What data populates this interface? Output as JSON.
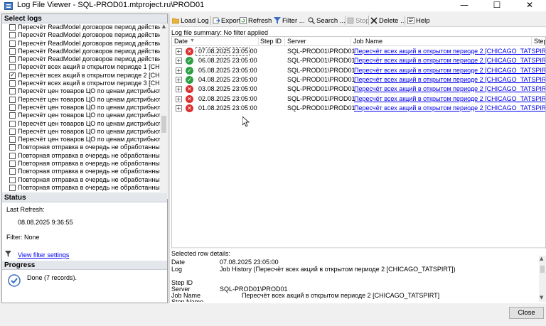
{
  "window": {
    "title": "Log File Viewer - SQL-PROD01.mtproject.ru\\PROD01",
    "minimize": "—",
    "maximize": "☐",
    "close": "✕"
  },
  "left": {
    "select_logs_header": "Select logs",
    "logs": [
      {
        "label": "Пересчёт ReadModel договоров период действия котор",
        "checked": false
      },
      {
        "label": "Пересчёт ReadModel договоров период действия котор",
        "checked": false
      },
      {
        "label": "Пересчёт ReadModel договоров период действия котор",
        "checked": false
      },
      {
        "label": "Пересчёт ReadModel договоров период действия котор",
        "checked": false
      },
      {
        "label": "Пересчёт ReadModel договоров период действия котор",
        "checked": false
      },
      {
        "label": "Пересчёт всех акций в открытом периоде 1 [CHICAGO_",
        "checked": false
      },
      {
        "label": "Пересчёт всех акций в открытом периоде 2 [CHICAGO_",
        "checked": true
      },
      {
        "label": "Пересчёт всех акций в открытом периоде 3 [CHICAGO_",
        "checked": false
      },
      {
        "label": "Пересчёт цен товаров ЦО по ценам дистрибьюторов [C",
        "checked": false
      },
      {
        "label": "Пересчёт цен товаров ЦО по ценам дистрибьюторов [C",
        "checked": false
      },
      {
        "label": "Пересчёт цен товаров ЦО по ценам дистрибьюторов [C",
        "checked": false
      },
      {
        "label": "Пересчёт цен товаров ЦО по ценам дистрибьюторов [C",
        "checked": false
      },
      {
        "label": "Пересчёт цен товаров ЦО по ценам дистрибьюторов [C",
        "checked": false
      },
      {
        "label": "Пересчёт цен товаров ЦО по ценам дистрибьюторов [C",
        "checked": false
      },
      {
        "label": "Пересчёт цен товаров ЦО по ценам дистрибьюторов [C",
        "checked": false
      },
      {
        "label": "Повторная отправка в очередь не обработанных данны",
        "checked": false
      },
      {
        "label": "Повторная отправка в очередь не обработанных данны",
        "checked": false
      },
      {
        "label": "Повторная отправка в очередь не обработанных данны",
        "checked": false
      },
      {
        "label": "Повторная отправка в очередь не обработанных данны",
        "checked": false
      },
      {
        "label": "Повторная отправка в очередь не обработанных данны",
        "checked": false
      },
      {
        "label": "Повторная отправка в очередь не обработанных данны",
        "checked": false
      }
    ],
    "status_header": "Status",
    "last_refresh_label": "Last Refresh:",
    "last_refresh_value": "08.08.2025 9:36:55",
    "filter_label": "Filter: None",
    "view_filter_link": "View filter settings",
    "progress_header": "Progress",
    "progress_text": "Done (7 records)."
  },
  "toolbar": {
    "load_log": "Load Log",
    "export": "Export",
    "refresh": "Refresh",
    "filter": "Filter ...",
    "search": "Search ...",
    "stop": "Stop",
    "delete": "Delete ...",
    "help": "Help"
  },
  "summary": "Log file summary: No filter applied",
  "grid": {
    "headers": {
      "date": "Date",
      "step_id": "Step ID",
      "server": "Server",
      "job_name": "Job Name",
      "extra": "Step N"
    },
    "rows": [
      {
        "status": "error",
        "date": "07.08.2025 23:05:00",
        "server": "SQL-PROD01\\PROD01",
        "job": "Пересчёт всех акций в открытом периоде 2 [CHICAGO_TATSPIRT]"
      },
      {
        "status": "success",
        "date": "06.08.2025 23:05:00",
        "server": "SQL-PROD01\\PROD01",
        "job": "Пересчёт всех акций в открытом периоде 2 [CHICAGO_TATSPIRT]"
      },
      {
        "status": "success",
        "date": "05.08.2025 23:05:00",
        "server": "SQL-PROD01\\PROD01",
        "job": "Пересчёт всех акций в открытом периоде 2 [CHICAGO_TATSPIRT]"
      },
      {
        "status": "success",
        "date": "04.08.2025 23:05:00",
        "server": "SQL-PROD01\\PROD01",
        "job": "Пересчёт всех акций в открытом периоде 2 [CHICAGO_TATSPIRT]"
      },
      {
        "status": "error",
        "date": "03.08.2025 23:05:00",
        "server": "SQL-PROD01\\PROD01",
        "job": "Пересчёт всех акций в открытом периоде 2 [CHICAGO_TATSPIRT]"
      },
      {
        "status": "error",
        "date": "02.08.2025 23:05:00",
        "server": "SQL-PROD01\\PROD01",
        "job": "Пересчёт всех акций в открытом периоде 2 [CHICAGO_TATSPIRT]"
      },
      {
        "status": "error",
        "date": "01.08.2025 23:05:00",
        "server": "SQL-PROD01\\PROD01",
        "job": "Пересчёт всех акций в открытом периоде 2 [CHICAGO_TATSPIRT]"
      }
    ]
  },
  "details": {
    "header": "Selected row details:",
    "date_label": "Date",
    "date_value": "07.08.2025 23:05:00",
    "log_label": "Log",
    "log_value": "Job History (Пересчёт всех акций в открытом периоде 2 [CHICAGO_TATSPIRT])",
    "step_label": "Step ID",
    "server_label": "Server",
    "server_value": "SQL-PROD01\\PROD01",
    "job_label": "Job Name",
    "job_value": "Пересчёт всех акций в открытом периоде 2 [CHICAGO_TATSPIRT]",
    "step_name_label": "Step Name"
  },
  "buttons": {
    "close": "Close"
  },
  "colors": {
    "error": "#d93030",
    "success": "#2ea043",
    "link": "#0000ee"
  }
}
